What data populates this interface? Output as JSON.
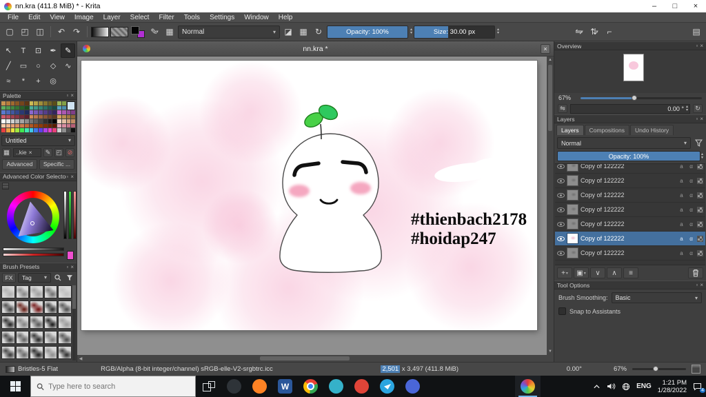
{
  "titlebar": {
    "title": "nn.kra (411.8 MiB) * - Krita",
    "minimize": "–",
    "maximize": "□",
    "close": "×"
  },
  "menubar": {
    "items": [
      "File",
      "Edit",
      "View",
      "Image",
      "Layer",
      "Select",
      "Filter",
      "Tools",
      "Settings",
      "Window",
      "Help"
    ]
  },
  "docker": {
    "float_glyph": "▫",
    "close_glyph": "×"
  },
  "toolbar": {
    "new_glyph": "▢",
    "open_glyph": "◰",
    "save_glyph": "◫",
    "undo_glyph": "↶",
    "redo_glyph": "↷",
    "brush_edit_glyph": "✎",
    "checker_glyph": "▦",
    "blend_mode": "Normal",
    "dropdown_arrow": "▾",
    "eraser_glyph": "◪",
    "preserve_alpha_glyph": "▦",
    "reload_glyph": "↻",
    "opacity_label": "Opacity: 100%",
    "size_label": "Size: 30.00 px",
    "size_fill_pct": 42,
    "mirror_h_glyph": "⇋",
    "mirror_v_glyph": "⇅",
    "wrap_glyph": "⌐",
    "workspace_glyph": "▤",
    "spin_up": "▴",
    "spin_down": "▾"
  },
  "toolbox": {
    "tools": [
      {
        "name": "transform-tool",
        "glyph": "↖"
      },
      {
        "name": "text-tool",
        "glyph": "T"
      },
      {
        "name": "crop-tool",
        "glyph": "⊡"
      },
      {
        "name": "calligraphy-tool",
        "glyph": "✒"
      },
      {
        "name": "freehand-brush-tool",
        "glyph": "✎",
        "active": true
      },
      {
        "name": "line-tool",
        "glyph": "╱"
      },
      {
        "name": "rectangle-tool",
        "glyph": "▭"
      },
      {
        "name": "ellipse-tool",
        "glyph": "○"
      },
      {
        "name": "polygon-tool",
        "glyph": "◇"
      },
      {
        "name": "polyline-tool",
        "glyph": "∿"
      },
      {
        "name": "dynamic-brush-tool",
        "glyph": "≈"
      },
      {
        "name": "multibrush-tool",
        "glyph": "*"
      },
      {
        "name": "assistants-tool",
        "glyph": "+"
      },
      {
        "name": "color-sampler-tool",
        "glyph": "◎"
      }
    ]
  },
  "palette": {
    "title": "Palette",
    "preset_name": "Untitled",
    "tag_label": "..kie",
    "tag_close": "×",
    "pencil_glyph": "✎",
    "folder_glyph": "◰",
    "block_glyph": "⊘",
    "grid_glyph": "▦",
    "advanced_label": "Advanced",
    "specific_label": "Specific ...",
    "current_color": "#cfe3f2",
    "rows": [
      [
        "#c8934f",
        "#b57d3c",
        "#a06a2f",
        "#8a5724",
        "#74451b",
        "#5e3513",
        "#cdbb55",
        "#b6a447",
        "#9f8d3a",
        "#88772e",
        "#716222",
        "#5a4d18",
        "#9ab554",
        "#83a046",
        "#6d8a39",
        "#58752d"
      ],
      [
        "#5eb05e",
        "#4f9c4f",
        "#418841",
        "#347434",
        "#286128",
        "#1d4e1d",
        "#4fae9b",
        "#429a88",
        "#368676",
        "#2b7264",
        "#215e53",
        "#174b42",
        "#58a2c4",
        "#4a8dad",
        "#3d7997",
        "#306581"
      ],
      [
        "#5b79cf",
        "#4e68b8",
        "#4158a1",
        "#35488a",
        "#2a3973",
        "#202b5d",
        "#8a68cf",
        "#7859b8",
        "#664ba1",
        "#553e8a",
        "#443173",
        "#34255d",
        "#c468c9",
        "#ad59b3",
        "#964b9d",
        "#803e87"
      ],
      [
        "#cf5b6e",
        "#b84e60",
        "#a14152",
        "#8a3545",
        "#732a38",
        "#5d202c",
        "#cf8a5b",
        "#b8784e",
        "#a16741",
        "#8a5635",
        "#73462a",
        "#5d3720",
        "#d1a05e",
        "#bb8d50",
        "#a47a43",
        "#8d6837"
      ],
      [
        "#ffffff",
        "#e8e8e8",
        "#d1d1d1",
        "#bababa",
        "#a3a3a3",
        "#8c8c8c",
        "#757575",
        "#5e5e5e",
        "#474747",
        "#303030",
        "#1a1a1a",
        "#000000",
        "#f2d9c6",
        "#e3bfa4",
        "#d3a583",
        "#c28b64"
      ],
      [
        "#f7c8a8",
        "#eeb48e",
        "#e4a076",
        "#d98d5f",
        "#cc7a4a",
        "#bf6836",
        "#b05724",
        "#a04714",
        "#8f3a0b",
        "#7d2f06",
        "#6b2503",
        "#591c01",
        "#e8a8b8",
        "#d88fa2",
        "#c8778c",
        "#b76077"
      ],
      [
        "#e84040",
        "#e8a040",
        "#e8e040",
        "#a0e840",
        "#40e850",
        "#40e8b0",
        "#40c8e8",
        "#4078e8",
        "#6040e8",
        "#b040e8",
        "#e840c8",
        "#e84078",
        "#d0d0d0",
        "#909090",
        "#505050",
        "#101010"
      ]
    ]
  },
  "advanced_color_selector": {
    "title": "Advanced Color Selector"
  },
  "brush_presets": {
    "title": "Brush Presets",
    "fx_label": "FX",
    "tag_label": "Tag",
    "thumbs": [
      "#b3b3b3",
      "#8c8c8c",
      "#a3a3a3",
      "#777777",
      "#c0c0c0",
      "#4d4d4d",
      "#6e2a22",
      "#7a2020",
      "#3d3d3d",
      "#595959",
      "#303030",
      "#8a8a8a",
      "#616161",
      "#272727",
      "#9e9e9e",
      "#484848",
      "#6b6b6b",
      "#343434",
      "#828282",
      "#565656",
      "#444444",
      "#707070",
      "#2b2b2b",
      "#959595",
      "#3a3a3a"
    ]
  },
  "document": {
    "tab_title": "nn.kra *",
    "close": "×"
  },
  "canvas": {
    "hashtag1": "#thienbach2178",
    "hashtag2": "#hoidap247"
  },
  "overview": {
    "title": "Overview",
    "zoom": "67%",
    "rotation": "0.00 °",
    "spin_up": "▴",
    "spin_down": "▾",
    "mirror_glyph": "⇋",
    "reset_glyph": "↻"
  },
  "layers": {
    "title": "Layers",
    "tabs": [
      {
        "label": "Layers",
        "active": true
      },
      {
        "label": "Compositions",
        "active": false
      },
      {
        "label": "Undo History",
        "active": false
      }
    ],
    "blend_mode": "Normal",
    "opacity_label": "Opacity:  100%",
    "row_icons": [
      {
        "name": "layer-alpha-lock-icon",
        "glyph": "a"
      },
      {
        "name": "layer-inherit-alpha-icon",
        "glyph": "α"
      }
    ],
    "rows": [
      {
        "name": "Copy of 122222",
        "selected": false
      },
      {
        "name": "Copy of 122222",
        "selected": false
      },
      {
        "name": "Copy of 122222",
        "selected": false
      },
      {
        "name": "Copy of 122222",
        "selected": false
      },
      {
        "name": "Copy of 122222",
        "selected": false
      },
      {
        "name": "Copy of 122222",
        "selected": true
      },
      {
        "name": "Copy of 122222",
        "selected": false
      }
    ],
    "buttons": [
      {
        "name": "add-layer-button",
        "glyph": "+",
        "caret": true
      },
      {
        "name": "duplicate-layer-button",
        "glyph": "▣",
        "caret": true
      },
      {
        "name": "move-layer-down-button",
        "glyph": "∨",
        "caret": false
      },
      {
        "name": "move-layer-up-button",
        "glyph": "∧",
        "caret": false
      },
      {
        "name": "layer-properties-button",
        "glyph": "≡",
        "caret": false
      }
    ]
  },
  "tool_options": {
    "title": "Tool Options",
    "smoothing_label": "Brush Smoothing:",
    "smoothing_value": "Basic",
    "snap_label": "Snap to Assistants"
  },
  "statusbar": {
    "preset_name": "Bristles-5 Flat",
    "color_profile": "RGB/Alpha (8-bit integer/channel)  sRGB-elle-V2-srgbtrc.icc",
    "dims_highlight": "2,501",
    "dims_rest": " x 3,497 (411.8 MiB)",
    "rotation": "0.00°",
    "zoom": "67%"
  },
  "taskbar": {
    "search_placeholder": "Type here to search",
    "apps": [
      {
        "name": "taskview-button",
        "type": "taskview"
      },
      {
        "name": "dark-browser-icon",
        "type": "dot",
        "color": "#2e3338"
      },
      {
        "name": "firefox-icon",
        "type": "dot",
        "color": "#ff8324"
      },
      {
        "name": "word-icon",
        "type": "letter",
        "color": "#2b579a",
        "letter": "W"
      },
      {
        "name": "chrome-icon",
        "type": "chrome"
      },
      {
        "name": "edge-icon",
        "type": "dot",
        "color": "#35b1c9"
      },
      {
        "name": "red-app-icon",
        "type": "dot",
        "color": "#e04438"
      },
      {
        "name": "telegram-icon",
        "type": "plane",
        "color": "#2ba5e0"
      },
      {
        "name": "blue-app-icon",
        "type": "dot",
        "color": "#4a66d8"
      },
      {
        "name": "krita-taskbar-icon",
        "type": "rainbow",
        "active": true
      }
    ],
    "tray": {
      "lang": "ENG",
      "time": "1:21 PM",
      "date": "1/28/2022",
      "badge": "4"
    }
  }
}
